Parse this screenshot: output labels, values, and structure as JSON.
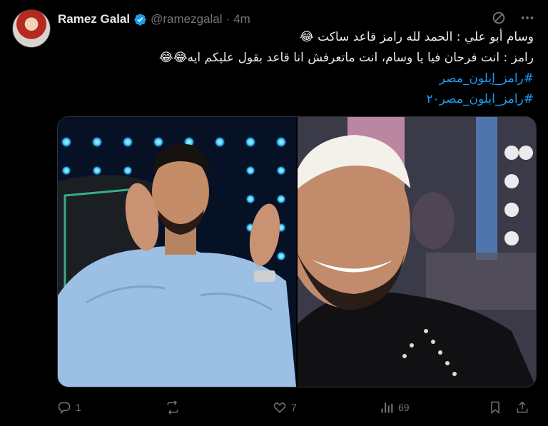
{
  "author": {
    "display_name": "Ramez Galal",
    "handle": "@ramezgalal",
    "separator": "·",
    "time": "4m",
    "verified": true
  },
  "text_lines": [
    "وسام أبو علي : الحمد لله رامز قاعد ساكت 😂",
    "رامز : انت فرحان فيا يا وسام، انت ماتعرفش انا قاعد بقول عليكم ايه😂😂"
  ],
  "hashtags": [
    "#رامز_إيلون_مصر",
    "#رامز_ايلون_مصر٢٠"
  ],
  "icons": {
    "grok": "grok-icon",
    "more": "more-icon",
    "reply": "reply-icon",
    "repost": "repost-icon",
    "like": "like-icon",
    "views": "views-icon",
    "bookmark": "bookmark-icon",
    "share": "share-icon"
  },
  "stats": {
    "replies": "1",
    "reposts": "",
    "likes": "7",
    "views": "69"
  },
  "colors": {
    "background": "#000000",
    "text": "#e7e9ea",
    "secondary": "#71767b",
    "link": "#1d9bf0",
    "verified": "#1d9bf0"
  }
}
